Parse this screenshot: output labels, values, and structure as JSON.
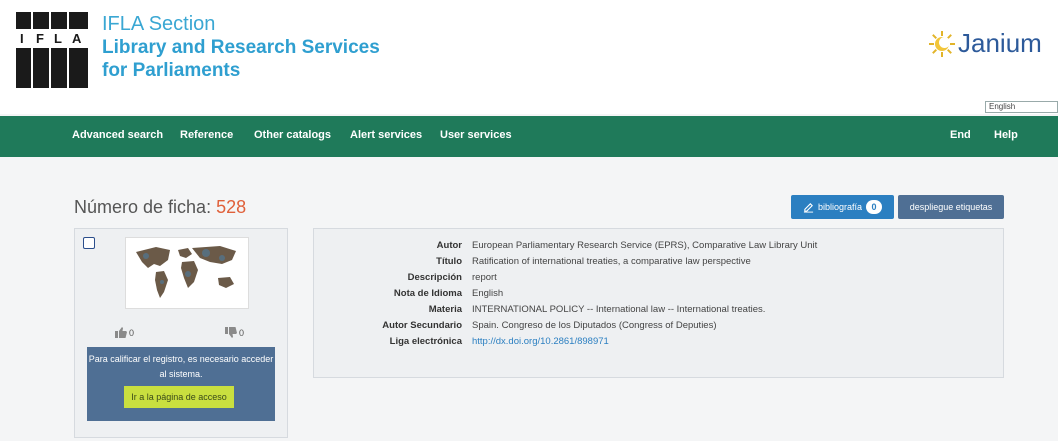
{
  "header": {
    "ifla_logo_text": "IFLA",
    "section_line1": "IFLA Section",
    "section_line2": "Library and Research Services",
    "section_line3": "for Parliaments",
    "janium_text": "Janium",
    "language": "English"
  },
  "nav": {
    "items": [
      "Advanced search",
      "Reference",
      "Other catalogs",
      "Alert services",
      "User services"
    ],
    "right_items": [
      "End",
      "Help"
    ]
  },
  "record": {
    "title_label": "Número de ficha:",
    "number": "528",
    "bibliografia_label": "bibliografía",
    "bibliografia_count": "0",
    "etiquetas_label": "despliegue etiquetas",
    "votes_up": "0",
    "votes_down": "0",
    "login_message": "Para calificar el registro, es necesario acceder al sistema.",
    "login_button": "Ir a la página de acceso",
    "fields": [
      {
        "label": "Autor",
        "value": "European Parliamentary Research Service (EPRS), Comparative Law Library Unit"
      },
      {
        "label": "Título",
        "value": "Ratification of international treaties, a comparative law perspective"
      },
      {
        "label": "Descripción",
        "value": "report"
      },
      {
        "label": "Nota de Idioma",
        "value": "English"
      },
      {
        "label": "Materia",
        "value": "INTERNATIONAL POLICY -- International law -- International treaties."
      },
      {
        "label": "Autor Secundario",
        "value": "Spain. Congreso de los Diputados (Congress of Deputies)"
      },
      {
        "label": "Liga electrónica",
        "value": "http://dx.doi.org/10.2861/898971"
      }
    ]
  },
  "colors": {
    "nav_bg": "#1f7a5a",
    "accent_blue": "#2b7fc1",
    "number_orange": "#e0603a",
    "login_button": "#c9df3f"
  }
}
